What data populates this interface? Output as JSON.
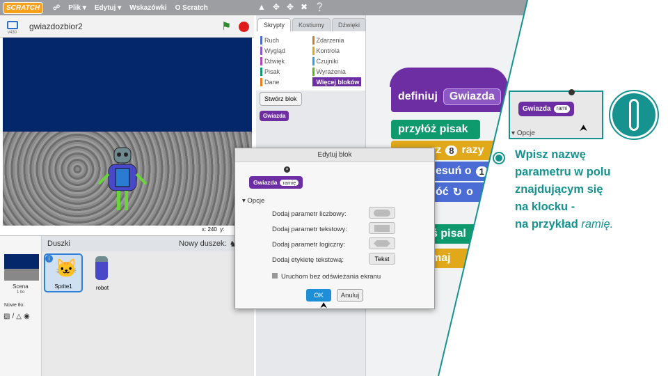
{
  "menubar": {
    "logo": "SCRATCH",
    "file": "Plik ▾",
    "edit": "Edytuj ▾",
    "tips": "Wskazówki",
    "about": "O Scratch"
  },
  "stage": {
    "project_title": "gwiazdozbior2",
    "version": "v430",
    "coord_x": "x: 240",
    "coord_y": "y:"
  },
  "sprites": {
    "header": "Duszki",
    "new_sprite": "Nowy duszek:",
    "scene_label": "Scena",
    "scene_sub": "1 tło",
    "new_bg": "Nowe tło:",
    "items": [
      "Sprite1",
      "robot"
    ]
  },
  "palette": {
    "tabs": [
      "Skrypty",
      "Kostiumy",
      "Dźwięki"
    ],
    "categories_left": [
      "Ruch",
      "Wygląd",
      "Dźwięk",
      "Pisak",
      "Dane"
    ],
    "categories_right": [
      "Zdarzenia",
      "Kontrola",
      "Czujniki",
      "Wyrażenia",
      "Więcej bloków"
    ],
    "make_block": "Stwórz blok",
    "custom_block": "Gwiazda"
  },
  "scripts": {
    "define": "definiuj",
    "define_name": "Gwiazda",
    "pen_down": "przyłóż pisak",
    "repeat": "rz",
    "repeat_num": "8",
    "repeat_tail": "razy",
    "move": "esuń o",
    "move_num": "1",
    "turn": "óć",
    "turn_tail": "o",
    "pen_up": "ś pisal",
    "set": "maj"
  },
  "dialog": {
    "title": "Edytuj blok",
    "block_name": "Gwiazda",
    "param": "ramię",
    "options": "Opcje",
    "add_number": "Dodaj parametr liczbowy:",
    "add_text": "Dodaj parametr tekstowy:",
    "add_bool": "Dodaj parametr logiczny:",
    "add_label": "Dodaj etykietę tekstową:",
    "label_btn": "Tekst",
    "no_refresh": "Uruchom bez odświeżania ekranu",
    "ok": "OK",
    "cancel": "Anuluj"
  },
  "callout": {
    "inset_block": "Gwiazda",
    "inset_param": "rami",
    "inset_options": "Opcje",
    "line1": "Wpisz nazwę",
    "line2": "parametru w polu",
    "line3": "znajdującym się",
    "line4": "na klocku -",
    "line5a": "na przykład ",
    "line5b": "ramię."
  },
  "colors": {
    "accent": "#16938f",
    "more_blocks": "#6c2ea2",
    "pen": "#0e9a6c",
    "control": "#e1a91a",
    "motion": "#4a6cd4"
  }
}
